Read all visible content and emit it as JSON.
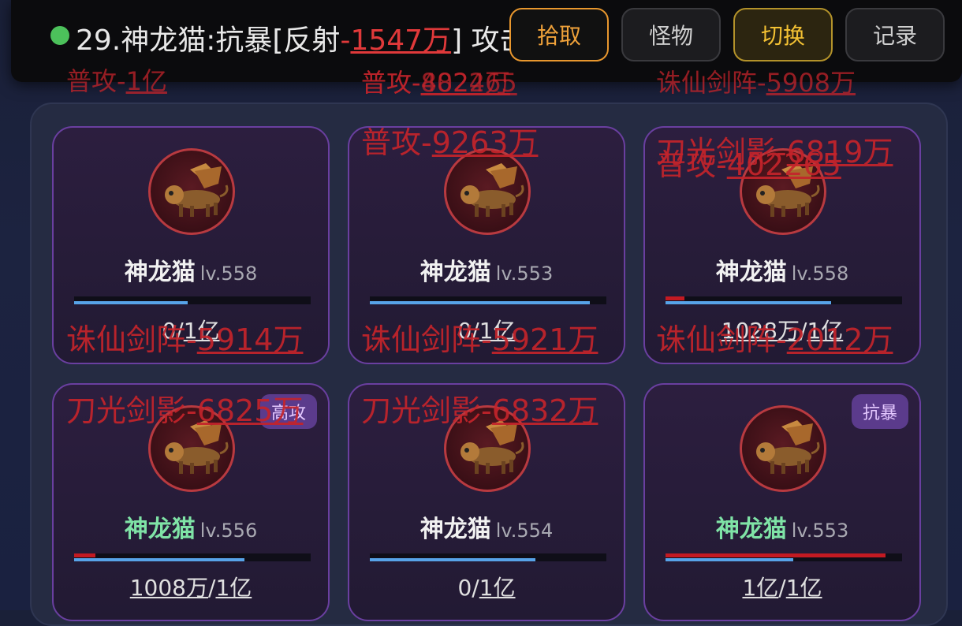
{
  "log": {
    "prefix": "29.神龙猫:抗暴[反射",
    "dash": "-",
    "value": "1547万",
    "suffix": "] 攻击"
  },
  "buttons": {
    "pick": "拾取",
    "monster": "怪物",
    "switch": "切换",
    "record": "记录"
  },
  "monsters": [
    {
      "name": "神龙猫",
      "level": "lv.558",
      "hp": "0",
      "max": "1亿",
      "name_color": "white",
      "tag": "",
      "hp_fraction": 0.0,
      "mp_fraction": 0.48
    },
    {
      "name": "神龙猫",
      "level": "lv.553",
      "hp": "0",
      "max": "1亿",
      "name_color": "white",
      "tag": "",
      "hp_fraction": 0.0,
      "mp_fraction": 0.93
    },
    {
      "name": "神龙猫",
      "level": "lv.558",
      "hp": "1028万",
      "max": "1亿",
      "name_color": "white",
      "tag": "",
      "hp_fraction": 0.08,
      "mp_fraction": 0.7
    },
    {
      "name": "神龙猫",
      "level": "lv.556",
      "hp": "1008万",
      "max": "1亿",
      "name_color": "green",
      "tag": "高攻",
      "hp_fraction": 0.09,
      "mp_fraction": 0.72
    },
    {
      "name": "神龙猫",
      "level": "lv.554",
      "hp": "0",
      "max": "1亿",
      "name_color": "white",
      "tag": "",
      "hp_fraction": 0.0,
      "mp_fraction": 0.7
    },
    {
      "name": "神龙猫",
      "level": "lv.553",
      "hp": "1亿",
      "max": "1亿",
      "name_color": "green",
      "tag": "抗暴",
      "hp_fraction": 0.93,
      "mp_fraction": 0.54
    }
  ],
  "hp_separator": "/",
  "damage": [
    {
      "label": "普攻",
      "value": "1亿"
    },
    {
      "label": "普攻",
      "value": "402265"
    },
    {
      "label": "普攻",
      "value": "8824万"
    },
    {
      "label": "诛仙剑阵",
      "value": "5908万"
    },
    {
      "label": "普攻",
      "value": "9263万"
    },
    {
      "label": "刀光剑影",
      "value": "6819万"
    },
    {
      "label": "普攻",
      "value": "402265"
    },
    {
      "label": "诛仙剑阵",
      "value": "5914万"
    },
    {
      "label": "诛仙剑阵",
      "value": "5921万"
    },
    {
      "label": "诛仙剑阵",
      "value": "2012万"
    },
    {
      "label": "刀光剑影",
      "value": "6825万"
    },
    {
      "label": "刀光剑影",
      "value": "6832万"
    }
  ],
  "dash": "-",
  "colors": {
    "accent_orange": "#e8972e",
    "accent_gold": "#f3c133",
    "damage_red": "#c4242b",
    "hp_red": "#c31a22",
    "mp_blue": "#57a3e8"
  },
  "icons": {
    "monster_portrait": "winged-lion-icon",
    "status": "green-dot-icon"
  }
}
